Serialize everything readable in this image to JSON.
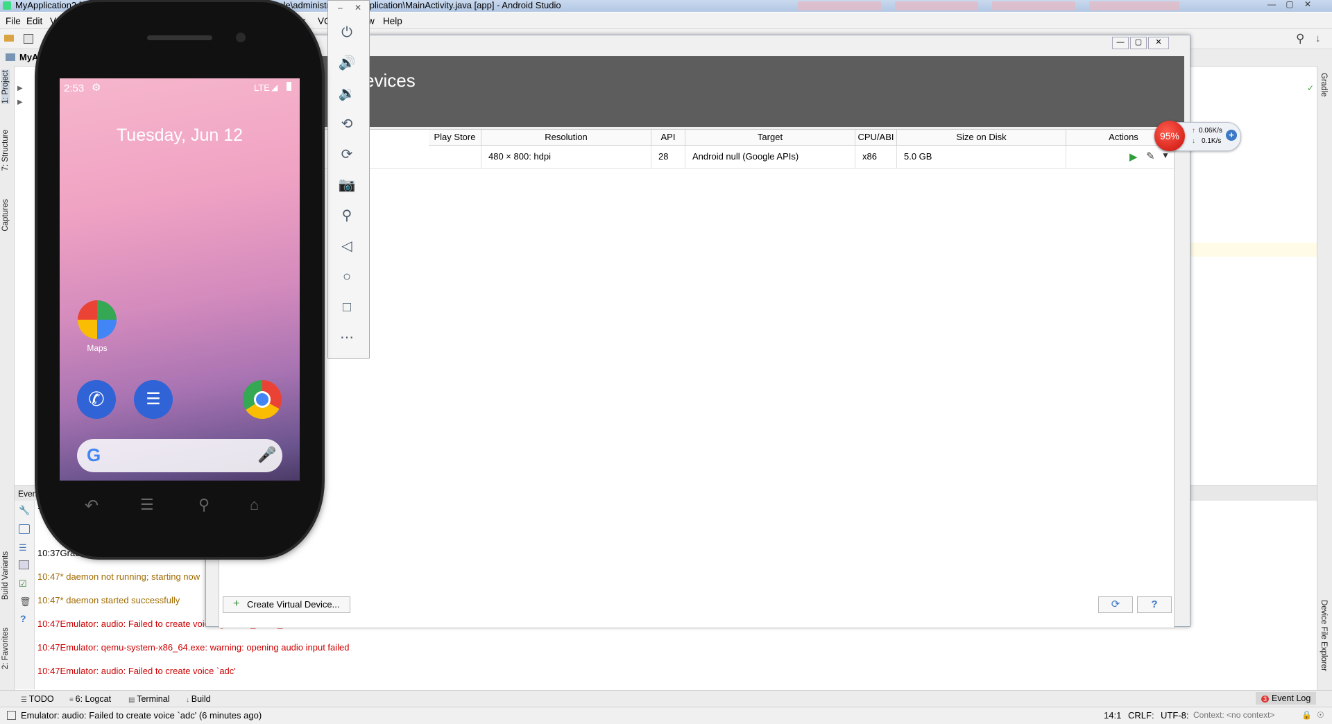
{
  "window": {
    "title": "MyApplication2 [C:\\U… MyApplication… \\src\\main\\java\\com\\example\\administrator\\myapplication\\MainActivity.java [app] - Android Studio",
    "controls": [
      "—",
      "▢",
      "✕"
    ]
  },
  "menu": [
    "File",
    "Edit",
    "V",
    "ls",
    "VC",
    "w",
    "Help"
  ],
  "nav": {
    "project": "MyA"
  },
  "left_tool_tabs": [
    "1: Project",
    "7: Structure",
    "Captures",
    "Build Variants",
    "2: Favorites"
  ],
  "right_tool_tabs": [
    "Gradle",
    "Device File Explorer"
  ],
  "avd_manager": {
    "title": "evices",
    "columns": [
      "Play Store",
      "Resolution",
      "API",
      "Target",
      "CPU/ABI",
      "Size on Disk",
      "Actions"
    ],
    "row": {
      "play_store": "",
      "resolution": "480 × 800: hdpi",
      "api": "28",
      "target": "Android null (Google APIs)",
      "cpu": "x86",
      "size": "5.0 GB"
    },
    "create_button": "Create Virtual Device...",
    "refresh_icon": "refresh-icon",
    "help_label": "?"
  },
  "speed_widget": {
    "percent": "95%",
    "up": "0.06K/s",
    "down": "0.1K/s"
  },
  "emulator": {
    "time": "2:53",
    "network": "LTE",
    "date": "Tuesday, Jun 12",
    "apps": [
      {
        "label": "Maps"
      }
    ]
  },
  "event_log": {
    "header": "Event",
    "lines": [
      {
        "time": "10:3",
        "text": "",
        "color": "#000000"
      },
      {
        "time": "10:37",
        "text": "Gradle sync finish",
        "color": "#000000"
      },
      {
        "time": "10:47",
        "text": "* daemon not running; starting now",
        "color": "#a06a00"
      },
      {
        "time": "10:47",
        "text": "* daemon started successfully",
        "color": "#a06a00"
      },
      {
        "time": "10:47",
        "text": "Emulator: audio: Failed to create voice `goldfish_audio_in'",
        "color": "#cc0000"
      },
      {
        "time": "10:47",
        "text": "Emulator: qemu-system-x86_64.exe: warning: opening audio input failed",
        "color": "#cc0000"
      },
      {
        "time": "10:47",
        "text": "Emulator: audio: Failed to create voice `adc'",
        "color": "#cc0000"
      }
    ]
  },
  "bottom_tabs": [
    "TODO",
    "6: Logcat",
    "Terminal",
    "Build",
    "Event Log"
  ],
  "event_log_badge": "3",
  "status": {
    "message": "Emulator: audio: Failed to create voice `adc' (6 minutes ago)",
    "position": "14:1",
    "line_sep": "CRLF:",
    "encoding": "UTF-8:",
    "context": "Context: <no context>"
  },
  "colors": {
    "header": "#5d5d5d",
    "error": "#cc0000",
    "warning": "#a06a00",
    "accent": "#2f6db5"
  }
}
